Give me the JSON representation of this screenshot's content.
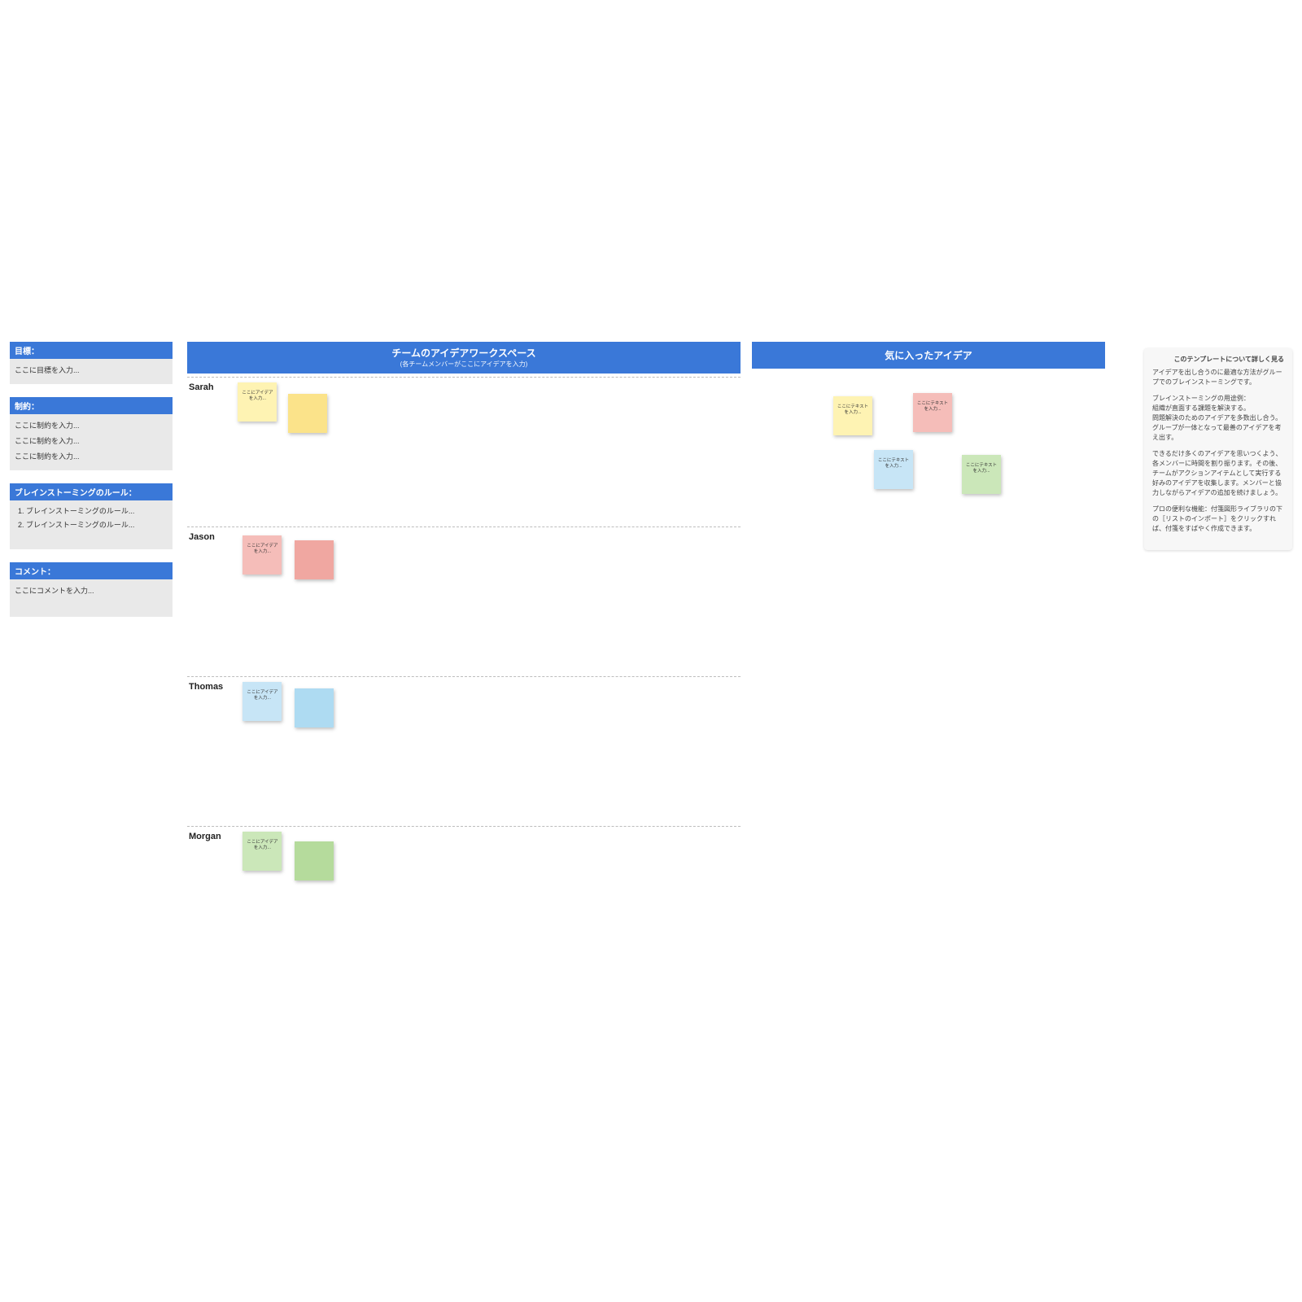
{
  "sidebar": {
    "goals": {
      "header": "目標：",
      "placeholder": "ここに目標を入力..."
    },
    "constraints": {
      "header": "制約：",
      "lines": [
        "ここに制約を入力...",
        "ここに制約を入力...",
        "ここに制約を入力..."
      ]
    },
    "rules": {
      "header": "ブレインストーミングのルール：",
      "items": [
        "ブレインストーミングのルール...",
        "ブレインストーミングのルール..."
      ]
    },
    "comments": {
      "header": "コメント：",
      "placeholder": "ここにコメントを入力..."
    }
  },
  "workspace": {
    "title": "チームのアイデアワークスペース",
    "subtitle": "(各チームメンバーがここにアイデアを入力)",
    "members": [
      "Sarah",
      "Jason",
      "Thomas",
      "Morgan"
    ],
    "sticky_text": "ここにアイデアを入力..."
  },
  "favorites": {
    "title": "気に入ったアイデア",
    "sticky_text": "ここにテキストを入力..."
  },
  "info": {
    "title": "このテンプレートについて詳しく見る",
    "p1": "アイデアを出し合うのに最適な方法がグループでのブレインストーミングです。",
    "p2": "ブレインストーミングの用途例：\n組織が直面する課題を解決する。\n問題解決のためのアイデアを多数出し合う。\nグループが一体となって最善のアイデアを考え出す。",
    "p3": "できるだけ多くのアイデアを思いつくよう、各メンバーに時間を割り振ります。その後、チームがアクションアイテムとして実行する好みのアイデアを収集します。メンバーと協力しながらアイデアの追加を続けましょう。",
    "p4": "プロの便利な機能：付箋図形ライブラリの下の［リストのインポート］をクリックすれば、付箋をすばやく作成できます。"
  },
  "colors": {
    "accent": "#3a78d8",
    "yellow": "#fef3b3",
    "yellow_dark": "#fbe38a",
    "red": "#f5bdb9",
    "red_dark": "#f0a7a1",
    "blue": "#c7e5f6",
    "blue_dark": "#aedbf2",
    "green": "#cbe7b9",
    "green_dark": "#b5db9c"
  }
}
